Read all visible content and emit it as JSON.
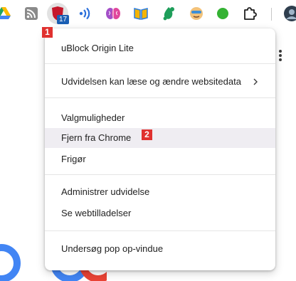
{
  "toolbar": {
    "extensions": [
      {
        "name": "google-drive-icon"
      },
      {
        "name": "rss-icon"
      },
      {
        "name": "ublock-origin-lite-icon",
        "badge": "17"
      },
      {
        "name": "broadcast-waves-icon"
      },
      {
        "name": "brain-icon"
      },
      {
        "name": "open-book-icon"
      },
      {
        "name": "leaf-drop-icon"
      },
      {
        "name": "face-glasses-icon"
      },
      {
        "name": "green-dot-icon"
      },
      {
        "name": "puzzle-piece-icon"
      },
      {
        "name": "profile-avatar-icon"
      }
    ]
  },
  "annotations": {
    "first": "1",
    "second": "2"
  },
  "menu": {
    "header": "uBlock Origin Lite",
    "site_access": "Udvidelsen kan læse og ændre websitedata",
    "options": "Valgmuligheder",
    "remove": "Fjern fra Chrome",
    "unpin": "Frigør",
    "manage": "Administrer udvidelse",
    "view_permissions": "Se webtilladelser",
    "inspect_popup": "Undersøg pop op-vindue"
  },
  "colors": {
    "annotation": "#e0312f",
    "hover_row": "#efedf2",
    "ublock_red": "#c5172b",
    "badge_blue": "#1a5fb4"
  }
}
